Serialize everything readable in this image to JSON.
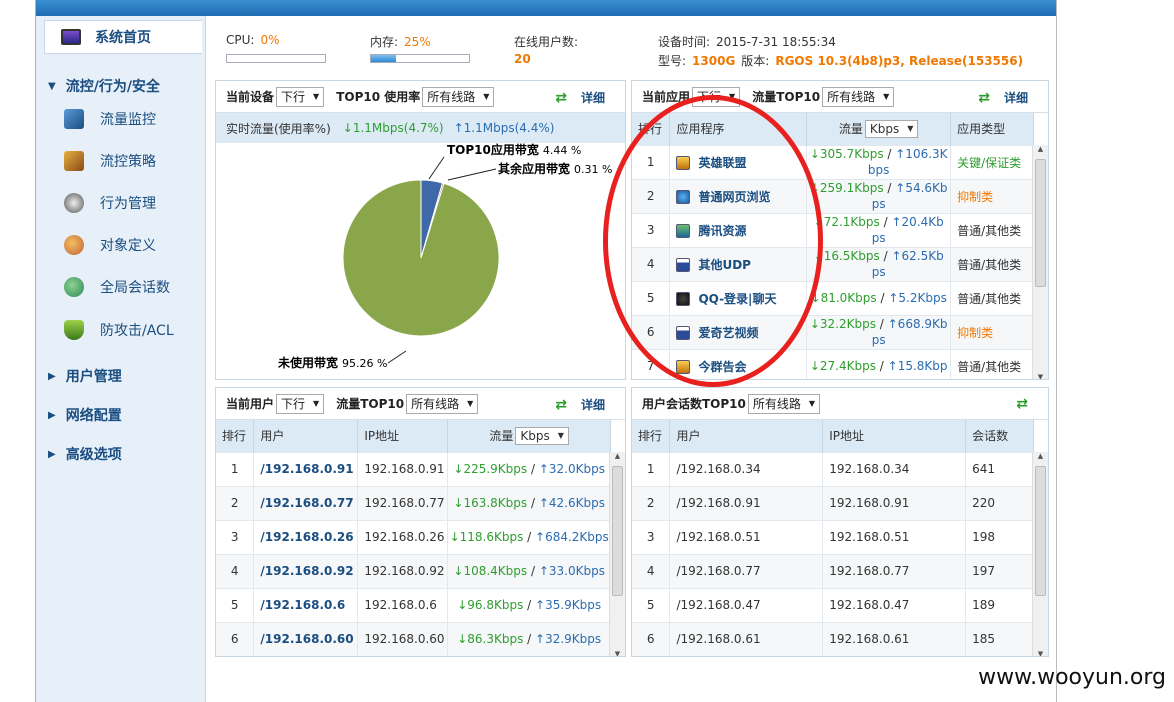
{
  "sidebar": {
    "home": "系统首页",
    "sections": [
      {
        "label": "流控/行为/安全",
        "expanded": true,
        "items": [
          "流量监控",
          "流控策略",
          "行为管理",
          "对象定义",
          "全局会话数",
          "防攻击/ACL"
        ]
      },
      {
        "label": "用户管理"
      },
      {
        "label": "网络配置"
      },
      {
        "label": "高级选项"
      }
    ]
  },
  "status": {
    "cpu_label": "CPU:",
    "cpu_value": "0%",
    "cpu_fraction": 0.0,
    "mem_label": "内存:",
    "mem_value": "25%",
    "mem_fraction": 0.25,
    "online_label": "在线用户数:",
    "online_value": "20",
    "time_label": "设备时间:",
    "time_value": "2015-7-31 18:55:34",
    "model_label": "型号:",
    "model_value": "1300G",
    "version_label": "版本:",
    "version_value": "RGOS 10.3(4b8)p3, Release(153556)"
  },
  "device_panel": {
    "title": "当前设备",
    "dir_select": "下行",
    "top10": "TOP10 使用率",
    "line_select": "所有线路",
    "detail": "详细",
    "flow_label": "实时流量(使用率%)",
    "down": "↓1.1Mbps(4.7%)",
    "up": "↑1.1Mbps(4.4%)",
    "pie_labels": {
      "app": "TOP10应用带宽",
      "app_pct": "4.44 %",
      "other": "其余应用带宽",
      "other_pct": "0.31 %",
      "unused": "未使用带宽",
      "unused_pct": "95.26 %"
    }
  },
  "chart_data": {
    "type": "pie",
    "slices": [
      {
        "name": "TOP10应用带宽",
        "value": 4.44,
        "color": "#3f68a8"
      },
      {
        "name": "其余应用带宽",
        "value": 0.31,
        "color": "#a84a3a"
      },
      {
        "name": "未使用带宽",
        "value": 95.26,
        "color": "#8aa64a"
      }
    ]
  },
  "app_panel": {
    "title": "当前应用",
    "dir_select": "下行",
    "top10": "流量TOP10",
    "line_select": "所有线路",
    "detail": "详细",
    "headers": [
      "排行",
      "应用程序",
      "流量",
      "应用类型"
    ],
    "unit_select": "Kbps",
    "rows": [
      {
        "rank": "1",
        "name": "英雄联盟",
        "down": "↓305.7Kbps",
        "up": "↑106.3K",
        "up2": "bps",
        "type": "关键/保证类",
        "type_color": "green",
        "icon": "game-icon"
      },
      {
        "rank": "2",
        "name": "普通网页浏览",
        "down": "↓259.1Kbps",
        "up": "↑54.6Kb",
        "up2": "ps",
        "type": "抑制类",
        "type_color": "orange",
        "icon": "ie-icon"
      },
      {
        "rank": "3",
        "name": "腾讯资源",
        "down": "↓72.1Kbps",
        "up": "↑20.4Kb",
        "up2": "ps",
        "type": "普通/其他类",
        "type_color": "normal",
        "icon": "download-icon"
      },
      {
        "rank": "4",
        "name": "其他UDP",
        "down": "↓16.5Kbps",
        "up": "↑62.5Kb",
        "up2": "ps",
        "type": "普通/其他类",
        "type_color": "normal",
        "icon": "window-icon"
      },
      {
        "rank": "5",
        "name": "QQ-登录|聊天",
        "down": "↓81.0Kbps",
        "up": "↑5.2Kbps",
        "up2": "",
        "type": "普通/其他类",
        "type_color": "normal",
        "icon": "qq-icon"
      },
      {
        "rank": "6",
        "name": "爱奇艺视频",
        "down": "↓32.2Kbps",
        "up": "↑668.9Kb",
        "up2": "ps",
        "type": "抑制类",
        "type_color": "orange",
        "icon": "window-icon"
      },
      {
        "rank": "7",
        "name": "今群告会",
        "down": "↓27.4Kbps",
        "up": "↑15.8Kbp",
        "up2": "",
        "type": "普通/其他类",
        "type_color": "normal",
        "icon": "game-icon"
      }
    ]
  },
  "user_panel": {
    "title": "当前用户",
    "dir_select": "下行",
    "top10": "流量TOP10",
    "line_select": "所有线路",
    "detail": "详细",
    "headers": [
      "排行",
      "用户",
      "IP地址",
      "流量"
    ],
    "unit_select": "Kbps",
    "rows": [
      {
        "rank": "1",
        "user": "/192.168.0.91",
        "ip": "192.168.0.91",
        "down": "↓225.9Kbps",
        "up": "↑32.0Kbps"
      },
      {
        "rank": "2",
        "user": "/192.168.0.77",
        "ip": "192.168.0.77",
        "down": "↓163.8Kbps",
        "up": "↑42.6Kbps"
      },
      {
        "rank": "3",
        "user": "/192.168.0.26",
        "ip": "192.168.0.26",
        "down": "↓118.6Kbps",
        "up": "↑684.2Kbps"
      },
      {
        "rank": "4",
        "user": "/192.168.0.92",
        "ip": "192.168.0.92",
        "down": "↓108.4Kbps",
        "up": "↑33.0Kbps"
      },
      {
        "rank": "5",
        "user": "/192.168.0.6",
        "ip": "192.168.0.6",
        "down": "↓96.8Kbps",
        "up": "↑35.9Kbps"
      },
      {
        "rank": "6",
        "user": "/192.168.0.60",
        "ip": "192.168.0.60",
        "down": "↓86.3Kbps",
        "up": "↑32.9Kbps"
      }
    ]
  },
  "session_panel": {
    "title": "用户会话数TOP10",
    "line_select": "所有线路",
    "headers": [
      "排行",
      "用户",
      "IP地址",
      "会话数"
    ],
    "rows": [
      {
        "rank": "1",
        "user": "/192.168.0.34",
        "ip": "192.168.0.34",
        "count": "641"
      },
      {
        "rank": "2",
        "user": "/192.168.0.91",
        "ip": "192.168.0.91",
        "count": "220"
      },
      {
        "rank": "3",
        "user": "/192.168.0.51",
        "ip": "192.168.0.51",
        "count": "198"
      },
      {
        "rank": "4",
        "user": "/192.168.0.77",
        "ip": "192.168.0.77",
        "count": "197"
      },
      {
        "rank": "5",
        "user": "/192.168.0.47",
        "ip": "192.168.0.47",
        "count": "189"
      },
      {
        "rank": "6",
        "user": "/192.168.0.61",
        "ip": "192.168.0.61",
        "count": "185"
      }
    ]
  },
  "watermark": "www.wooyun.org",
  "colors": {
    "accent": "#1a4d80",
    "up": "#2b6cb0",
    "down": "#2e9e2e",
    "warn": "#f07800",
    "highlight": "#e8201e"
  }
}
